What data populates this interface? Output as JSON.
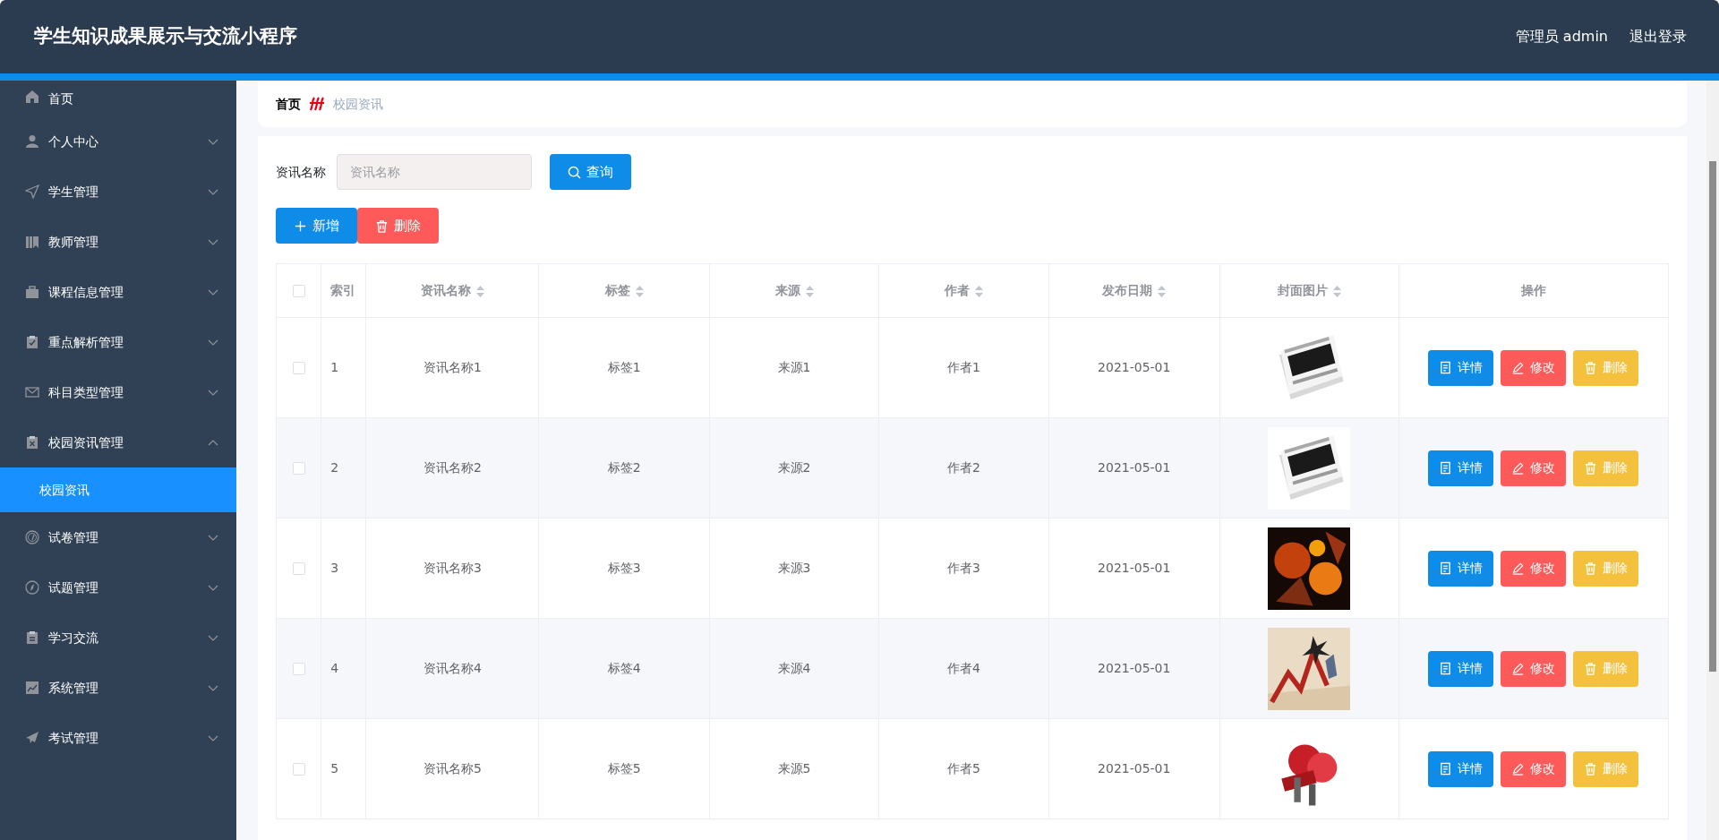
{
  "header": {
    "title": "学生知识成果展示与交流小程序",
    "user": "管理员 admin",
    "logout": "退出登录"
  },
  "sidebar": {
    "items": [
      {
        "label": "首页",
        "kind": "link"
      },
      {
        "label": "个人中心",
        "kind": "menu",
        "expanded": false
      },
      {
        "label": "学生管理",
        "kind": "menu",
        "expanded": false
      },
      {
        "label": "教师管理",
        "kind": "menu",
        "expanded": false
      },
      {
        "label": "课程信息管理",
        "kind": "menu",
        "expanded": false
      },
      {
        "label": "重点解析管理",
        "kind": "menu",
        "expanded": false
      },
      {
        "label": "科目类型管理",
        "kind": "menu",
        "expanded": false
      },
      {
        "label": "校园资讯管理",
        "kind": "menu",
        "expanded": true,
        "children": [
          {
            "label": "校园资讯",
            "selected": true
          }
        ]
      },
      {
        "label": "试卷管理",
        "kind": "menu",
        "expanded": false
      },
      {
        "label": "试题管理",
        "kind": "menu",
        "expanded": false
      },
      {
        "label": "学习交流",
        "kind": "menu",
        "expanded": false
      },
      {
        "label": "系统管理",
        "kind": "menu",
        "expanded": false
      },
      {
        "label": "考试管理",
        "kind": "menu",
        "expanded": false
      }
    ]
  },
  "breadcrumb": [
    {
      "label": "首页",
      "current": false
    },
    {
      "label": "校园资讯",
      "current": true
    }
  ],
  "search": {
    "label": "资讯名称",
    "placeholder": "资讯名称",
    "button": "查询"
  },
  "actions": [
    {
      "label": "新增",
      "kind": "add"
    },
    {
      "label": "删除",
      "kind": "delete"
    }
  ],
  "table": {
    "select_all": false,
    "columns": [
      {
        "label": "索引",
        "sortable": false
      },
      {
        "label": "资讯名称",
        "sortable": true
      },
      {
        "label": "标签",
        "sortable": true
      },
      {
        "label": "来源",
        "sortable": true
      },
      {
        "label": "作者",
        "sortable": true
      },
      {
        "label": "发布日期",
        "sortable": true
      },
      {
        "label": "封面图片",
        "sortable": true
      },
      {
        "label": "操作",
        "sortable": false
      }
    ],
    "rows": [
      {
        "checked": false,
        "index": "1",
        "name": "资讯名称1",
        "tag": "标签1",
        "source": "来源1",
        "author": "作者1",
        "date": "2021-05-01",
        "buttons": [
          {
            "label": "详情",
            "kind": "detail"
          },
          {
            "label": "修改",
            "kind": "edit"
          },
          {
            "label": "删除",
            "kind": "delete"
          }
        ]
      },
      {
        "checked": false,
        "index": "2",
        "name": "资讯名称2",
        "tag": "标签2",
        "source": "来源2",
        "author": "作者2",
        "date": "2021-05-01",
        "buttons": [
          {
            "label": "详情",
            "kind": "detail"
          },
          {
            "label": "修改",
            "kind": "edit"
          },
          {
            "label": "删除",
            "kind": "delete"
          }
        ]
      },
      {
        "checked": false,
        "index": "3",
        "name": "资讯名称3",
        "tag": "标签3",
        "source": "来源3",
        "author": "作者3",
        "date": "2021-05-01",
        "buttons": [
          {
            "label": "详情",
            "kind": "detail"
          },
          {
            "label": "修改",
            "kind": "edit"
          },
          {
            "label": "删除",
            "kind": "delete"
          }
        ]
      },
      {
        "checked": false,
        "index": "4",
        "name": "资讯名称4",
        "tag": "标签4",
        "source": "来源4",
        "author": "作者4",
        "date": "2021-05-01",
        "buttons": [
          {
            "label": "详情",
            "kind": "detail"
          },
          {
            "label": "修改",
            "kind": "edit"
          },
          {
            "label": "删除",
            "kind": "delete"
          }
        ]
      },
      {
        "checked": false,
        "index": "5",
        "name": "资讯名称5",
        "tag": "标签5",
        "source": "来源5",
        "author": "作者5",
        "date": "2021-05-01",
        "buttons": [
          {
            "label": "详情",
            "kind": "detail"
          },
          {
            "label": "修改",
            "kind": "edit"
          },
          {
            "label": "删除",
            "kind": "delete"
          }
        ]
      }
    ]
  }
}
